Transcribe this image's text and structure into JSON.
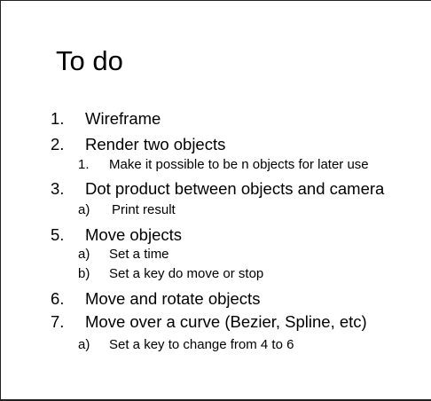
{
  "title": "To do",
  "items": [
    {
      "level": 1,
      "marker": "1.",
      "text": "Wireframe"
    },
    {
      "level": 1,
      "marker": "2.",
      "text": "Render two objects"
    },
    {
      "level": 2,
      "marker": "1.",
      "text": "Make it possible to be n objects for later use"
    },
    {
      "level": 1,
      "marker": "3.",
      "text": "Dot product between objects and camera"
    },
    {
      "level": 2,
      "marker": "a)",
      "text": "Print result"
    },
    {
      "level": 1,
      "marker": "5.",
      "text": "Move objects"
    },
    {
      "level": 2,
      "marker": "a)",
      "text": "Set a time"
    },
    {
      "level": 2,
      "marker": "b)",
      "text": "Set a key do move or stop"
    },
    {
      "level": 1,
      "marker": "6.",
      "text": "Move and rotate objects"
    },
    {
      "level": 1,
      "marker": "7.",
      "text": "Move over a curve (Bezier, Spline, etc)"
    },
    {
      "level": 2,
      "marker": "a)",
      "text": "Set a key to change from 4 to 6"
    }
  ]
}
